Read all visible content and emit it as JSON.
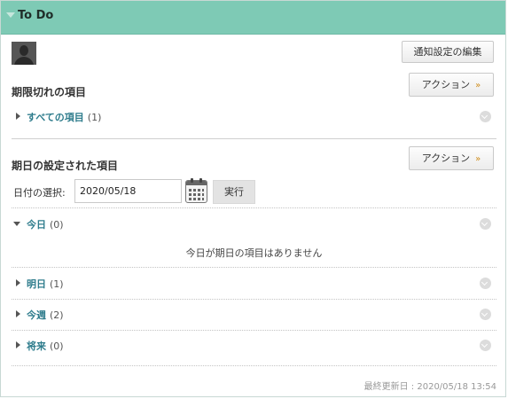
{
  "module": {
    "title": "To Do",
    "notify_button": "通知設定の編集",
    "footer": "最終更新日 : 2020/05/18 13:54"
  },
  "overdue": {
    "title": "期限切れの項目",
    "action_button": "アクション",
    "all_items": {
      "label": "すべての項目",
      "count": "(1)"
    }
  },
  "due": {
    "title": "期日の設定された項目",
    "action_button": "アクション",
    "date_label": "日付の選択:",
    "date_value": "2020/05/18",
    "exec_button": "実行",
    "groups": [
      {
        "label": "今日",
        "count": "(0)",
        "expanded": true
      },
      {
        "label": "明日",
        "count": "(1)",
        "expanded": false
      },
      {
        "label": "今週",
        "count": "(2)",
        "expanded": false
      },
      {
        "label": "将来",
        "count": "(0)",
        "expanded": false
      }
    ],
    "today_empty_message": "今日が期日の項目はありません"
  },
  "colors": {
    "header_bg": "#7ecab5",
    "link": "#2e7c8c",
    "chevron_accent": "#d08d1c"
  },
  "icons": [
    "collapse-triangle-icon",
    "avatar-icon",
    "chevron-down-double-icon",
    "caret-right-icon",
    "caret-down-icon",
    "circle-chevron-icon",
    "calendar-icon"
  ]
}
